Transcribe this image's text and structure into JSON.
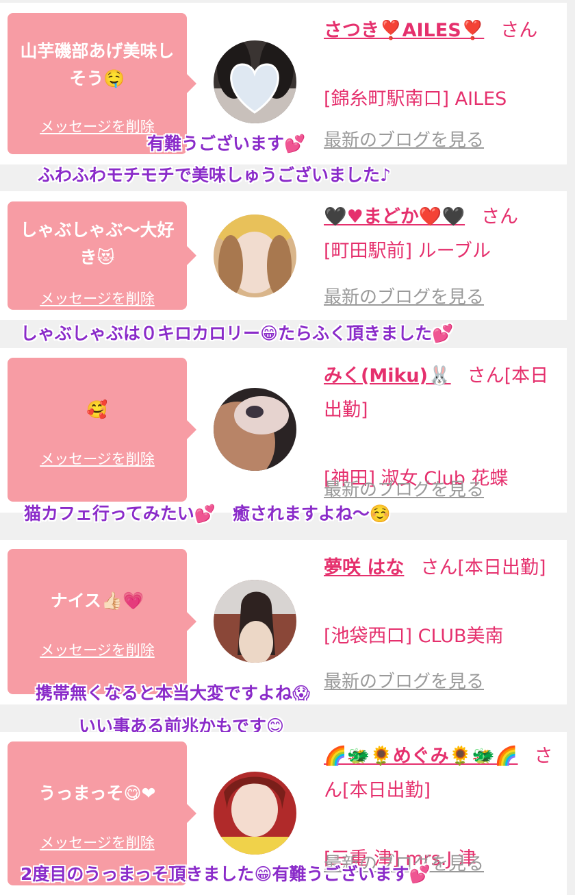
{
  "colors": {
    "bubble": "#f79ca4",
    "name": "#e5306d",
    "link_gray": "#9a9a9a",
    "caption": "#8a2bc9",
    "background": "#f0f0f0"
  },
  "entries": [
    {
      "message": "山芋磯部あげ美味しそう🤤",
      "delete_label": "メッセージを削除",
      "name": "さつき❣️AILES❣️",
      "suffix": "さん",
      "detail": "",
      "shop": "[錦糸町駅南口] AILES",
      "blog_label": "最新のブログを見る",
      "avatar_icon": "heart-masked-profile-photo",
      "captions": [
        "有難うございます💕",
        "ふわふわモチモチで美味しゅうございました♪"
      ]
    },
    {
      "message": "しゃぶしゃぶ〜大好き😻",
      "delete_label": "メッセージを削除",
      "name": "🖤♥まどか❤️🖤",
      "suffix": "さん",
      "detail": "",
      "shop": "[町田駅前] ルーブル",
      "blog_label": "最新のブログを見る",
      "avatar_icon": "profile-photo",
      "captions": [
        "しゃぶしゃぶは０キロカロリー😁たらふく頂きました💕"
      ]
    },
    {
      "message": "🥰",
      "delete_label": "メッセージを削除",
      "name": "みく(Miku)🐰",
      "suffix": "さん[本日出勤]",
      "detail": "",
      "shop": "[神田] 淑女 Club 花蝶",
      "blog_label": "最新のブログを見る",
      "avatar_icon": "profile-photo",
      "captions": [
        "猫カフェ行ってみたい💕　癒されますよね〜☺️"
      ]
    },
    {
      "message": "ナイス👍🏻💗",
      "delete_label": "メッセージを削除",
      "name": "夢咲 はな",
      "suffix": "さん[本日出勤]",
      "detail": "",
      "shop": "[池袋西口] CLUB美南",
      "blog_label": "最新のブログを見る",
      "avatar_icon": "profile-photo",
      "captions": [
        "携帯無くなると本当大変ですよね😱",
        "いい事ある前兆かもです😊"
      ]
    },
    {
      "message": "うっまっそ😋❤",
      "delete_label": "メッセージを削除",
      "name": "🌈🐲🌻めぐみ🌻🐲🌈",
      "suffix": "さん[本日出勤]",
      "detail": "",
      "shop": "[三重 津] mrs.J 津",
      "blog_label": "最新のブログを見る",
      "avatar_icon": "profile-photo",
      "captions": [
        "2度目のうっまっそ頂きました😁有難うございます💕"
      ]
    }
  ]
}
